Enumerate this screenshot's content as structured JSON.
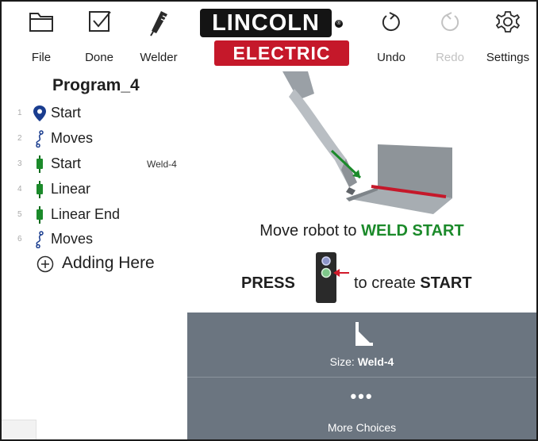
{
  "toolbar": {
    "file": "File",
    "done": "Done",
    "welder": "Welder",
    "undo": "Undo",
    "redo": "Redo",
    "settings": "Settings"
  },
  "logo": {
    "top": "LINCOLN",
    "bottom": "ELECTRIC",
    "reg": "®"
  },
  "program": {
    "title": "Program_4",
    "steps": [
      {
        "num": "1",
        "label": "Start",
        "icon": "location-pin-icon",
        "tag": ""
      },
      {
        "num": "2",
        "label": "Moves",
        "icon": "move-path-icon",
        "tag": ""
      },
      {
        "num": "3",
        "label": "Start",
        "icon": "weld-torch-icon",
        "tag": "Weld-4"
      },
      {
        "num": "4",
        "label": "Linear",
        "icon": "weld-torch-icon",
        "tag": ""
      },
      {
        "num": "5",
        "label": "Linear End",
        "icon": "weld-torch-icon",
        "tag": ""
      },
      {
        "num": "6",
        "label": "Moves",
        "icon": "move-path-icon",
        "tag": ""
      }
    ],
    "add_here": "Adding Here"
  },
  "instructions": {
    "move_prefix": "Move robot to ",
    "move_target": "WELD START",
    "press": "PRESS",
    "create_prefix": "to create ",
    "create_target": "START"
  },
  "panel": {
    "size_prefix": "Size: ",
    "size_value": "Weld-4",
    "more_icon": "•••",
    "more_label": "More Choices"
  },
  "colors": {
    "accent_green": "#1b8a2a",
    "brand_red": "#c5182a",
    "panel_gray": "#6b7580",
    "step_blue": "#1a3d8f"
  }
}
